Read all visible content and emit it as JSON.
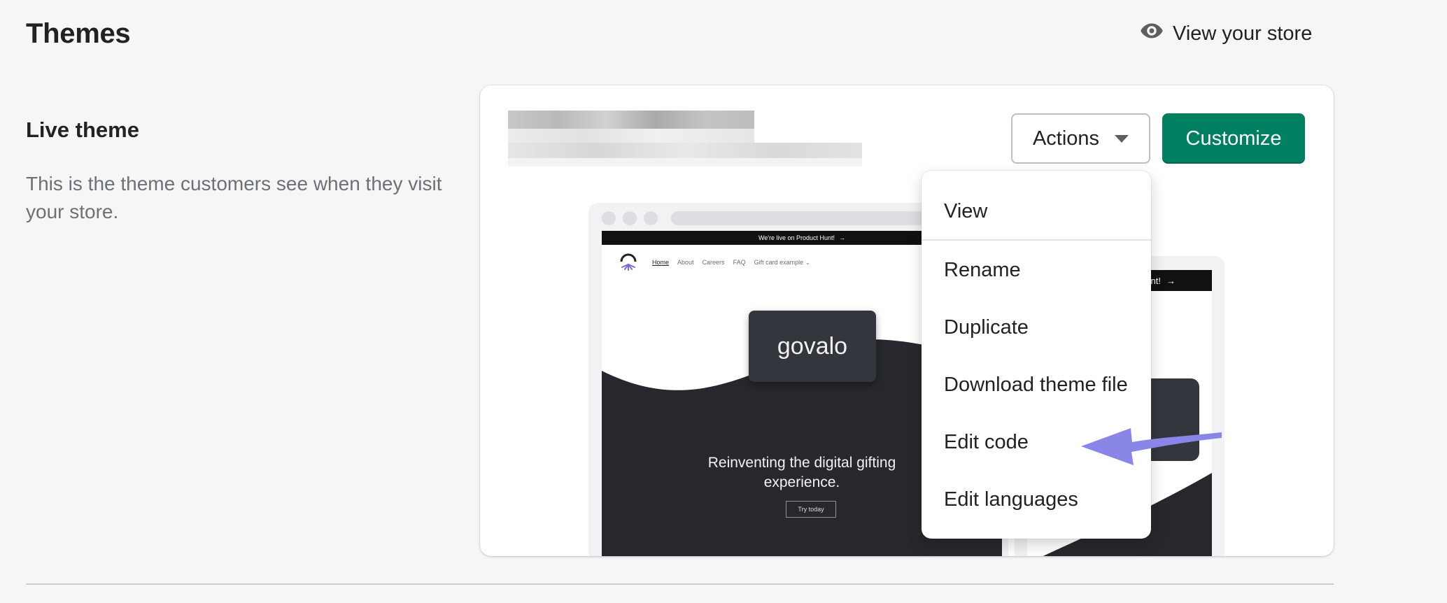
{
  "header": {
    "title": "Themes",
    "view_store_label": "View your store",
    "view_store_icon": "eye-icon"
  },
  "section": {
    "title": "Live theme",
    "description": "This is the theme customers see when they visit your store."
  },
  "theme_card": {
    "actions_label": "Actions",
    "customize_label": "Customize",
    "accent_color": "#008060"
  },
  "preview": {
    "announcement": "We're live on Product Hunt!",
    "nav": [
      "Home",
      "About",
      "Careers",
      "FAQ",
      "Gift card example"
    ],
    "brand": "govalo",
    "hero_title_line1": "Reinventing the digital gifting",
    "hero_title_line2": "experience.",
    "hero_button": "Try today",
    "mobile_announcement": "nt!"
  },
  "actions_menu": {
    "items": [
      "View",
      "Rename",
      "Duplicate",
      "Download theme file",
      "Edit code",
      "Edit languages"
    ]
  },
  "annotation": {
    "arrow_color": "#8a86e8"
  }
}
